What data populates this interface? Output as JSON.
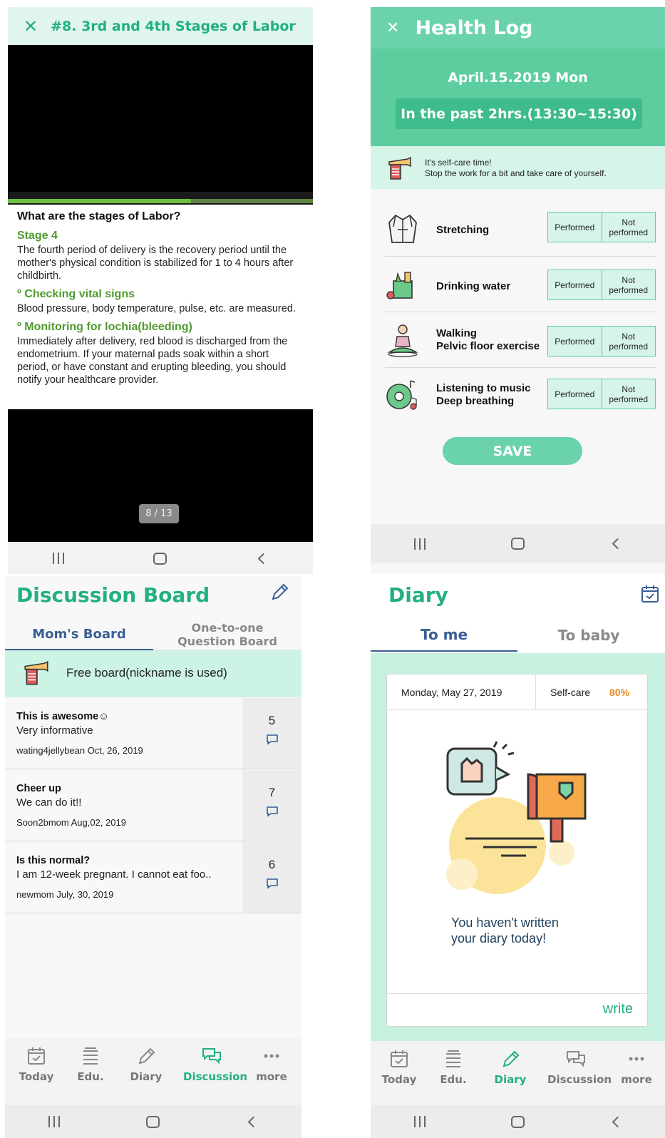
{
  "lesson": {
    "close_icon": "close-icon",
    "title": "#8. 3rd and 4th Stages of Labor",
    "progress_fraction": 0.6,
    "question": "What are the stages of Labor?",
    "stage_heading": "Stage 4",
    "stage_text": "The fourth period of delivery is the recovery period until the mother's physical condition is stabilized for 1 to 4 hours after childbirth.",
    "vital_heading": "º Checking vital signs",
    "vital_text": "Blood pressure, body temperature, pulse, etc. are measured.",
    "lochia_heading": "º Monitoring for lochia(bleeding)",
    "lochia_text": "Immediately after delivery, red blood is discharged from the endometrium. If your maternal pads soak within a short period, or have constant and erupting bleeding, you should notify your healthcare provider.",
    "pager": "8 / 13"
  },
  "health_log": {
    "title": "Health Log",
    "date": "April.15.2019 Mon",
    "period": "In the past 2hrs.(13:30~15:30)",
    "notice_line1": "It's self-care time!",
    "notice_line2": "Stop the work for a bit and take care of yourself.",
    "performed_label": "Performed",
    "not_performed_label": "Not performed",
    "items": [
      {
        "line1": "Stretching",
        "line2": "",
        "icon": "robe-icon"
      },
      {
        "line1": "Drinking water",
        "line2": "",
        "icon": "grocery-bag-icon"
      },
      {
        "line1": "Walking",
        "line2": "Pelvic floor exercise",
        "icon": "meditation-icon"
      },
      {
        "line1": "Listening to music",
        "line2": "Deep breathing",
        "icon": "music-record-icon"
      }
    ],
    "save_label": "SAVE"
  },
  "discussion": {
    "title": "Discussion Board",
    "edit_icon": "pencil-icon",
    "tab_active": "Mom's Board",
    "tab_other_line1": "One-to-one",
    "tab_other_line2": "Question Board",
    "free_board": "Free board(nickname is used)",
    "posts": [
      {
        "title": "This is awesome☺",
        "body": "Very informative",
        "meta": "wating4jellybean  Oct, 26, 2019",
        "count": "5"
      },
      {
        "title": "Cheer up",
        "body": "We can do it!!",
        "meta": "Soon2bmom  Aug,02, 2019",
        "count": "7"
      },
      {
        "title": "Is this normal?",
        "body": "I am 12-week pregnant. I cannot eat foo..",
        "meta": "newmom  July, 30, 2019",
        "count": "6"
      }
    ]
  },
  "diary": {
    "title": "Diary",
    "tab_active": "To me",
    "tab_other": "To baby",
    "date": "Monday, May 27, 2019",
    "selfcare_label": "Self-care",
    "selfcare_value": "80%",
    "message_line1": "You haven't written",
    "message_line2": "your diary today!",
    "write_label": "write"
  },
  "tabs": {
    "today": "Today",
    "edu": "Edu.",
    "diary": "Diary",
    "discussion": "Discussion",
    "more": "more"
  },
  "colors": {
    "brand_green": "#22b07f",
    "header_green": "#6bd3ab",
    "active_tab_blue": "#3a5f95",
    "accent_orange": "#e98a1c"
  }
}
